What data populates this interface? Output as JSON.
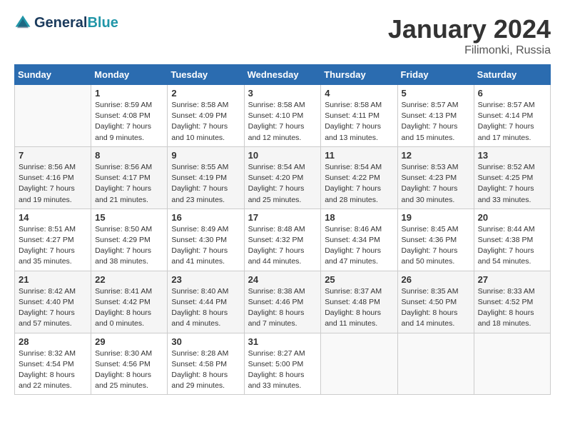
{
  "header": {
    "logo_line1": "General",
    "logo_line2": "Blue",
    "month": "January 2024",
    "location": "Filimonki, Russia"
  },
  "days_of_week": [
    "Sunday",
    "Monday",
    "Tuesday",
    "Wednesday",
    "Thursday",
    "Friday",
    "Saturday"
  ],
  "weeks": [
    [
      {
        "day": "",
        "info": ""
      },
      {
        "day": "1",
        "info": "Sunrise: 8:59 AM\nSunset: 4:08 PM\nDaylight: 7 hours\nand 9 minutes."
      },
      {
        "day": "2",
        "info": "Sunrise: 8:58 AM\nSunset: 4:09 PM\nDaylight: 7 hours\nand 10 minutes."
      },
      {
        "day": "3",
        "info": "Sunrise: 8:58 AM\nSunset: 4:10 PM\nDaylight: 7 hours\nand 12 minutes."
      },
      {
        "day": "4",
        "info": "Sunrise: 8:58 AM\nSunset: 4:11 PM\nDaylight: 7 hours\nand 13 minutes."
      },
      {
        "day": "5",
        "info": "Sunrise: 8:57 AM\nSunset: 4:13 PM\nDaylight: 7 hours\nand 15 minutes."
      },
      {
        "day": "6",
        "info": "Sunrise: 8:57 AM\nSunset: 4:14 PM\nDaylight: 7 hours\nand 17 minutes."
      }
    ],
    [
      {
        "day": "7",
        "info": "Sunrise: 8:56 AM\nSunset: 4:16 PM\nDaylight: 7 hours\nand 19 minutes."
      },
      {
        "day": "8",
        "info": "Sunrise: 8:56 AM\nSunset: 4:17 PM\nDaylight: 7 hours\nand 21 minutes."
      },
      {
        "day": "9",
        "info": "Sunrise: 8:55 AM\nSunset: 4:19 PM\nDaylight: 7 hours\nand 23 minutes."
      },
      {
        "day": "10",
        "info": "Sunrise: 8:54 AM\nSunset: 4:20 PM\nDaylight: 7 hours\nand 25 minutes."
      },
      {
        "day": "11",
        "info": "Sunrise: 8:54 AM\nSunset: 4:22 PM\nDaylight: 7 hours\nand 28 minutes."
      },
      {
        "day": "12",
        "info": "Sunrise: 8:53 AM\nSunset: 4:23 PM\nDaylight: 7 hours\nand 30 minutes."
      },
      {
        "day": "13",
        "info": "Sunrise: 8:52 AM\nSunset: 4:25 PM\nDaylight: 7 hours\nand 33 minutes."
      }
    ],
    [
      {
        "day": "14",
        "info": "Sunrise: 8:51 AM\nSunset: 4:27 PM\nDaylight: 7 hours\nand 35 minutes."
      },
      {
        "day": "15",
        "info": "Sunrise: 8:50 AM\nSunset: 4:29 PM\nDaylight: 7 hours\nand 38 minutes."
      },
      {
        "day": "16",
        "info": "Sunrise: 8:49 AM\nSunset: 4:30 PM\nDaylight: 7 hours\nand 41 minutes."
      },
      {
        "day": "17",
        "info": "Sunrise: 8:48 AM\nSunset: 4:32 PM\nDaylight: 7 hours\nand 44 minutes."
      },
      {
        "day": "18",
        "info": "Sunrise: 8:46 AM\nSunset: 4:34 PM\nDaylight: 7 hours\nand 47 minutes."
      },
      {
        "day": "19",
        "info": "Sunrise: 8:45 AM\nSunset: 4:36 PM\nDaylight: 7 hours\nand 50 minutes."
      },
      {
        "day": "20",
        "info": "Sunrise: 8:44 AM\nSunset: 4:38 PM\nDaylight: 7 hours\nand 54 minutes."
      }
    ],
    [
      {
        "day": "21",
        "info": "Sunrise: 8:42 AM\nSunset: 4:40 PM\nDaylight: 7 hours\nand 57 minutes."
      },
      {
        "day": "22",
        "info": "Sunrise: 8:41 AM\nSunset: 4:42 PM\nDaylight: 8 hours\nand 0 minutes."
      },
      {
        "day": "23",
        "info": "Sunrise: 8:40 AM\nSunset: 4:44 PM\nDaylight: 8 hours\nand 4 minutes."
      },
      {
        "day": "24",
        "info": "Sunrise: 8:38 AM\nSunset: 4:46 PM\nDaylight: 8 hours\nand 7 minutes."
      },
      {
        "day": "25",
        "info": "Sunrise: 8:37 AM\nSunset: 4:48 PM\nDaylight: 8 hours\nand 11 minutes."
      },
      {
        "day": "26",
        "info": "Sunrise: 8:35 AM\nSunset: 4:50 PM\nDaylight: 8 hours\nand 14 minutes."
      },
      {
        "day": "27",
        "info": "Sunrise: 8:33 AM\nSunset: 4:52 PM\nDaylight: 8 hours\nand 18 minutes."
      }
    ],
    [
      {
        "day": "28",
        "info": "Sunrise: 8:32 AM\nSunset: 4:54 PM\nDaylight: 8 hours\nand 22 minutes."
      },
      {
        "day": "29",
        "info": "Sunrise: 8:30 AM\nSunset: 4:56 PM\nDaylight: 8 hours\nand 25 minutes."
      },
      {
        "day": "30",
        "info": "Sunrise: 8:28 AM\nSunset: 4:58 PM\nDaylight: 8 hours\nand 29 minutes."
      },
      {
        "day": "31",
        "info": "Sunrise: 8:27 AM\nSunset: 5:00 PM\nDaylight: 8 hours\nand 33 minutes."
      },
      {
        "day": "",
        "info": ""
      },
      {
        "day": "",
        "info": ""
      },
      {
        "day": "",
        "info": ""
      }
    ]
  ]
}
